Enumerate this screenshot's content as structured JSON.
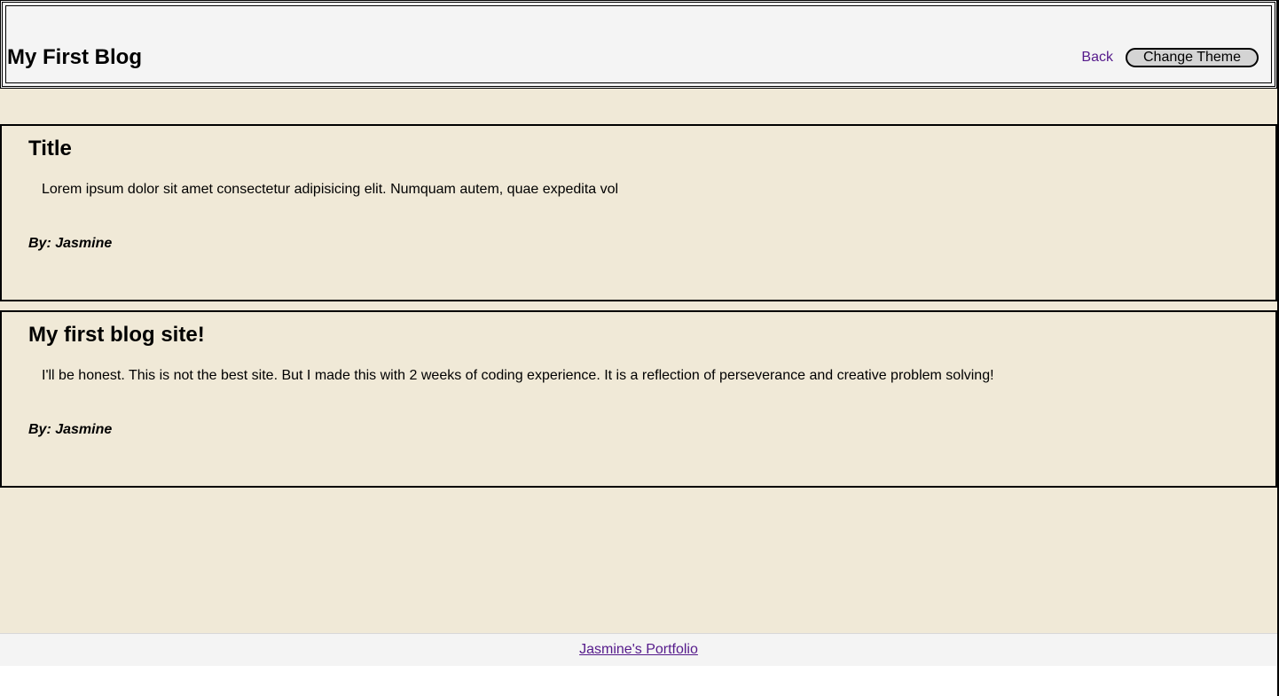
{
  "header": {
    "title": "My First Blog",
    "nav": {
      "back_label": "Back",
      "theme_button_label": "Change Theme"
    }
  },
  "posts": [
    {
      "title": "Title",
      "body": "Lorem ipsum dolor sit amet consectetur adipisicing elit. Numquam autem, quae expedita vol",
      "author": "By: Jasmine"
    },
    {
      "title": "My first blog site!",
      "body": "I'll be honest. This is not the best site. But I made this with 2 weeks of coding experience. It is a reflection of perseverance and creative problem solving!",
      "author": "By: Jasmine"
    }
  ],
  "footer": {
    "link_label": "Jasmine's Portfolio"
  },
  "colors": {
    "background": "#f0e9d7",
    "header_bg": "#f4f4f4",
    "link": "#551a8b",
    "button_bg": "#d4d4d4"
  }
}
